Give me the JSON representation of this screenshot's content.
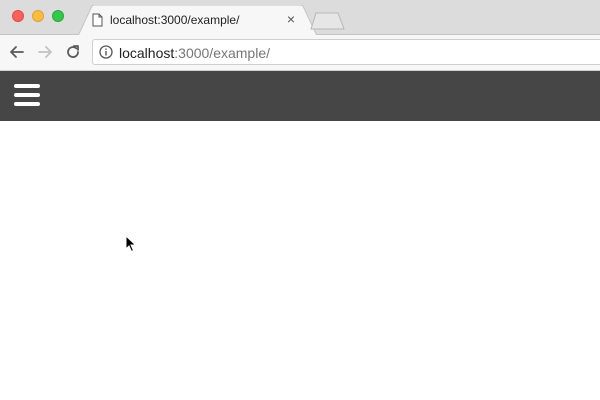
{
  "window": {
    "controls": [
      "close",
      "minimize",
      "zoom"
    ]
  },
  "tab": {
    "title": "localhost:3000/example/",
    "icon": "page-icon",
    "close_label": "×"
  },
  "toolbar": {
    "back_icon": "arrow-left-icon",
    "forward_icon": "arrow-right-icon",
    "reload_icon": "reload-icon"
  },
  "omnibox": {
    "info_icon": "info-icon",
    "url_host": "localhost",
    "url_rest": ":3000/example/"
  },
  "page": {
    "navbar": {
      "menu_icon": "hamburger-menu-icon",
      "background": "#464646"
    }
  }
}
